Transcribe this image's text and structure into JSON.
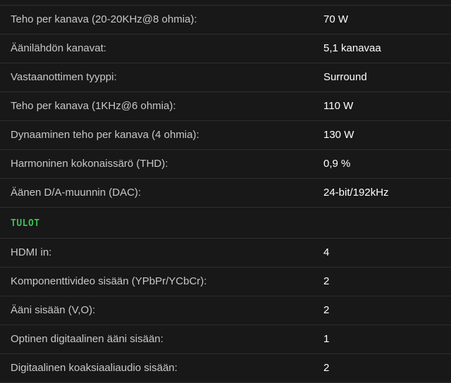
{
  "colors": {
    "background": "#181818",
    "divider": "#2e2e2e",
    "label": "#c8c8c8",
    "value": "#ffffff",
    "section_heading": "#3fbf4f"
  },
  "amplifier_specs": [
    {
      "label": "Teho per kanava (20-20KHz@8 ohmia):",
      "value": "70 W"
    },
    {
      "label": "Äänilähdön kanavat:",
      "value": "5,1 kanavaa"
    },
    {
      "label": "Vastaanottimen tyyppi:",
      "value": "Surround"
    },
    {
      "label": "Teho per kanava (1KHz@6 ohmia):",
      "value": "110 W"
    },
    {
      "label": "Dynaaminen teho per kanava (4 ohmia):",
      "value": "130 W"
    },
    {
      "label": "Harmoninen kokonaissärö (THD):",
      "value": "0,9 %"
    },
    {
      "label": "Äänen D/A-muunnin (DAC):",
      "value": "24-bit/192kHz"
    }
  ],
  "inputs_section": {
    "heading": "TULOT",
    "rows": [
      {
        "label": "HDMI in:",
        "value": "4"
      },
      {
        "label": "Komponenttivideo sisään (YPbPr/YCbCr):",
        "value": "2"
      },
      {
        "label": "Ääni sisään (V,O):",
        "value": "2"
      },
      {
        "label": "Optinen digitaalinen ääni sisään:",
        "value": "1"
      },
      {
        "label": "Digitaalinen koaksiaaliaudio sisään:",
        "value": "2"
      }
    ]
  }
}
